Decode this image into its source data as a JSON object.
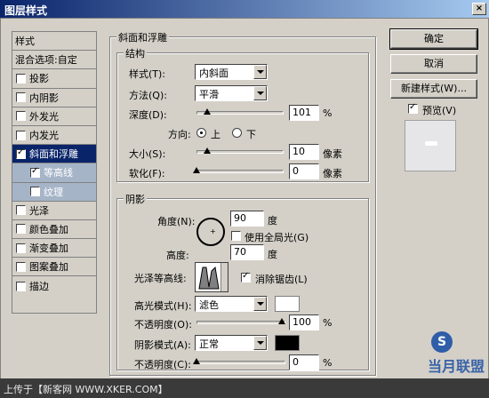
{
  "window": {
    "title": "图层样式",
    "close": "×"
  },
  "sidebar": {
    "items": [
      {
        "label": "样式",
        "type": "header"
      },
      {
        "label": "混合选项:自定",
        "type": "header"
      },
      {
        "label": "投影",
        "checked": false
      },
      {
        "label": "内阴影",
        "checked": false
      },
      {
        "label": "外发光",
        "checked": false
      },
      {
        "label": "内发光",
        "checked": false
      },
      {
        "label": "斜面和浮雕",
        "checked": true,
        "selected": true
      },
      {
        "label": "等高线",
        "checked": true,
        "sub": true
      },
      {
        "label": "纹理",
        "checked": false,
        "sub": true
      },
      {
        "label": "光泽",
        "checked": false
      },
      {
        "label": "颜色叠加",
        "checked": false
      },
      {
        "label": "渐变叠加",
        "checked": false
      },
      {
        "label": "图案叠加",
        "checked": false
      },
      {
        "label": "描边",
        "checked": false
      }
    ]
  },
  "bevel": {
    "section_title": "斜面和浮雕",
    "structure_title": "结构",
    "style_label": "样式(T):",
    "style_value": "内斜面",
    "method_label": "方法(Q):",
    "method_value": "平滑",
    "depth_label": "深度(D):",
    "depth_value": "101",
    "depth_unit": "%",
    "direction_label": "方向:",
    "dir_up": "上",
    "dir_down": "下",
    "size_label": "大小(S):",
    "size_value": "10",
    "size_unit": "像素",
    "soften_label": "软化(F):",
    "soften_value": "0",
    "soften_unit": "像素"
  },
  "shading": {
    "title": "阴影",
    "angle_label": "角度(N):",
    "angle_value": "90",
    "angle_unit": "度",
    "global_light_label": "使用全局光(G)",
    "altitude_label": "高度:",
    "altitude_value": "70",
    "altitude_unit": "度",
    "gloss_label": "光泽等高线:",
    "antialias_label": "消除锯齿(L)",
    "highlight_mode_label": "高光模式(H):",
    "highlight_mode_value": "滤色",
    "highlight_opacity_label": "不透明度(O):",
    "highlight_opacity_value": "100",
    "highlight_opacity_unit": "%",
    "shadow_mode_label": "阴影模式(A):",
    "shadow_mode_value": "正常",
    "shadow_opacity_label": "不透明度(C):",
    "shadow_opacity_value": "0",
    "shadow_opacity_unit": "%",
    "highlight_color": "#ffffff",
    "shadow_color": "#000000"
  },
  "buttons": {
    "ok": "确定",
    "cancel": "取消",
    "new_style": "新建样式(W)...",
    "preview": "预览(V)"
  },
  "status": {
    "text": "上传于【新客网 WWW.XKER.COM】"
  },
  "watermark": {
    "text": "当月联盟",
    "letter": "S"
  }
}
